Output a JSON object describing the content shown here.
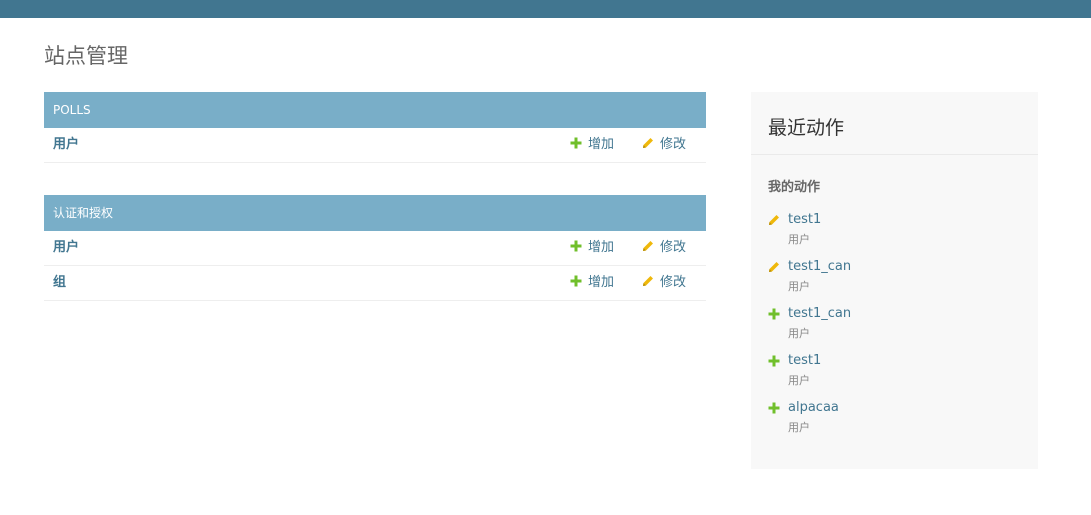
{
  "page": {
    "title": "站点管理"
  },
  "modules": [
    {
      "caption": "POLLS",
      "rows": [
        {
          "name": "用户",
          "add": "增加",
          "change": "修改"
        }
      ]
    },
    {
      "caption": "认证和授权",
      "rows": [
        {
          "name": "用户",
          "add": "增加",
          "change": "修改"
        },
        {
          "name": "组",
          "add": "增加",
          "change": "修改"
        }
      ]
    }
  ],
  "recent": {
    "title": "最近动作",
    "subtitle": "我的动作",
    "items": [
      {
        "action": "change",
        "icon": "pencil-icon",
        "link": "test1",
        "type": "用户"
      },
      {
        "action": "change",
        "icon": "pencil-icon",
        "link": "test1_can",
        "type": "用户"
      },
      {
        "action": "add",
        "icon": "plus-icon",
        "link": "test1_can",
        "type": "用户"
      },
      {
        "action": "add",
        "icon": "plus-icon",
        "link": "test1",
        "type": "用户"
      },
      {
        "action": "add",
        "icon": "plus-icon",
        "link": "alpacaa",
        "type": "用户"
      }
    ]
  },
  "colors": {
    "header": "#417690",
    "caption": "#79aec8",
    "link": "#417690",
    "add_icon": "#70bf2b",
    "change_icon": "#efb80b"
  }
}
